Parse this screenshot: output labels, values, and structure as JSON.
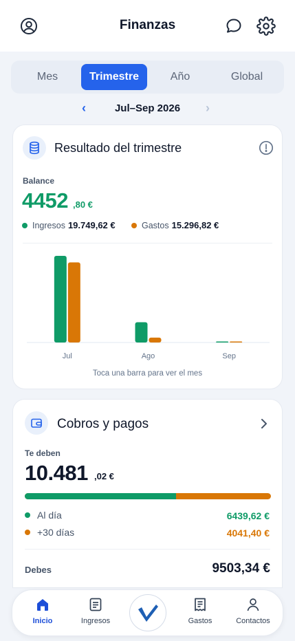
{
  "header": {
    "title": "Finanzas",
    "icons": [
      "user-circle-icon",
      "chat-icon",
      "gear-icon"
    ]
  },
  "tabs": [
    {
      "label": "Mes",
      "active": false
    },
    {
      "label": "Trimestre",
      "active": true
    },
    {
      "label": "Año",
      "active": false
    },
    {
      "label": "Global",
      "active": false
    }
  ],
  "period": {
    "label": "Jul–Sep 2026",
    "prev": "‹",
    "next": "›"
  },
  "summary": {
    "title": "Resultado del trimestre",
    "balance_label": "Balance",
    "balance_int": "4452",
    "balance_dec": ",80 €",
    "income_label": "Ingresos",
    "income_value": "19.749,62 €",
    "expense_label": "Gastos",
    "expense_value": "15.296,82 €",
    "hint": "Toca una barra para ver el mes"
  },
  "chart_data": {
    "type": "bar",
    "categories": [
      "Jul",
      "Ago",
      "Sep"
    ],
    "series": [
      {
        "name": "Ingresos",
        "values": [
          16000,
          3750,
          0
        ]
      },
      {
        "name": "Gastos",
        "values": [
          14800,
          900,
          0
        ]
      }
    ],
    "ylim": [
      0,
      16000
    ],
    "grid": false,
    "colors": [
      "#0f9b67",
      "#d97706"
    ]
  },
  "collections": {
    "title": "Cobros y pagos",
    "owed_label": "Te deben",
    "owed_int": "10.481",
    "owed_dec": ",02 €",
    "progress_on_time_fraction": 0.614,
    "rows": [
      {
        "label": "Al día",
        "value": "6439,62 €",
        "color": "#0f9b67"
      },
      {
        "label": "+30 días",
        "value": "4041,40 €",
        "color": "#d97706"
      }
    ],
    "debt_label": "Debes",
    "debt_value": "9503,34 €"
  },
  "nav": [
    {
      "label": "Inicio",
      "icon": "home-icon",
      "active": true
    },
    {
      "label": "Ingresos",
      "icon": "document-icon",
      "active": false
    },
    {
      "label": "Gastos",
      "icon": "receipt-icon",
      "active": false
    },
    {
      "label": "Contactos",
      "icon": "user-icon",
      "active": false
    }
  ],
  "colors": {
    "accent": "#2563eb",
    "green": "#0f9b67",
    "orange": "#d97706"
  }
}
